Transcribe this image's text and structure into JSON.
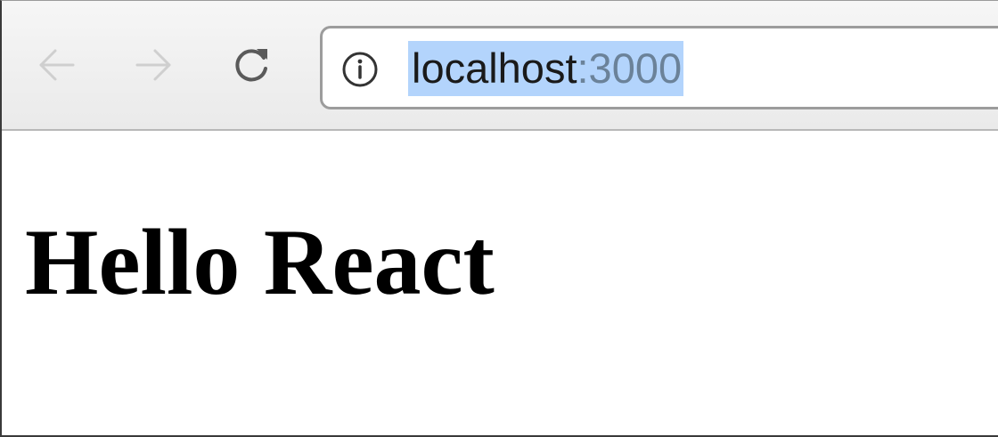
{
  "toolbar": {
    "back_icon": "back-arrow-icon",
    "forward_icon": "forward-arrow-icon",
    "reload_icon": "reload-icon"
  },
  "address_bar": {
    "security_icon": "info-icon",
    "host": "localhost",
    "port": ":3000",
    "selection_color": "#b3d4fc"
  },
  "page": {
    "heading": "Hello React"
  }
}
